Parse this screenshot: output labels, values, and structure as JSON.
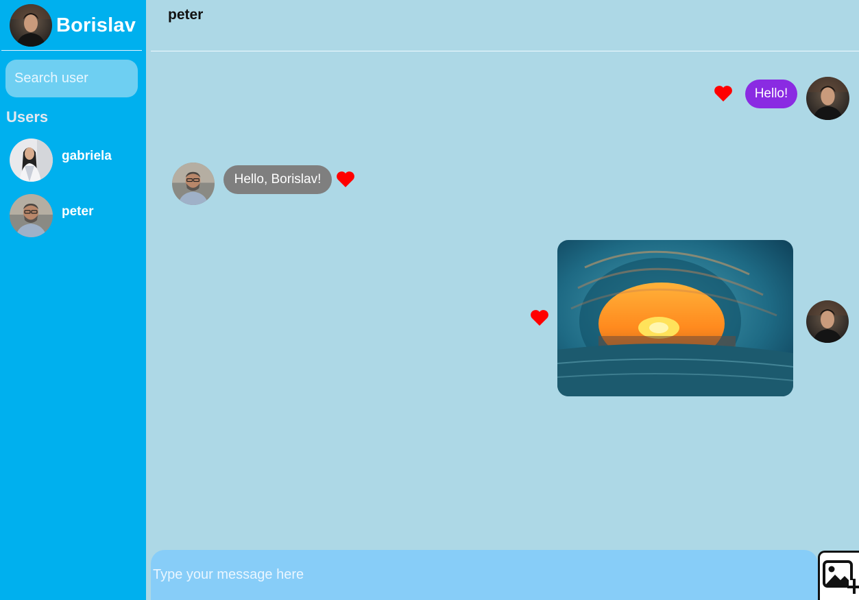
{
  "colors": {
    "sidebar": "#00b0ee",
    "chat_bg": "#add8e6",
    "outgoing_bubble": "#8a2be2",
    "incoming_bubble": "#7f7f7f",
    "heart": "#ff0000",
    "composer": "#87cdf8"
  },
  "sidebar": {
    "current_user": "Borislav",
    "search": {
      "placeholder": "Search user"
    },
    "users_heading": "Users",
    "users": [
      {
        "name": "gabriela",
        "avatar": "avatar-gabriela"
      },
      {
        "name": "peter",
        "avatar": "avatar-peter"
      }
    ]
  },
  "chat": {
    "title": "peter",
    "messages": [
      {
        "direction": "outgoing",
        "type": "text",
        "text": "Hello!",
        "liked": true
      },
      {
        "direction": "incoming",
        "type": "text",
        "text": "Hello, Borislav!",
        "liked": true
      },
      {
        "direction": "outgoing",
        "type": "image",
        "image": "ocean-wave-sunset",
        "liked": true
      }
    ]
  },
  "composer": {
    "placeholder": "Type your message here",
    "attach_icon": "add-image-icon"
  }
}
